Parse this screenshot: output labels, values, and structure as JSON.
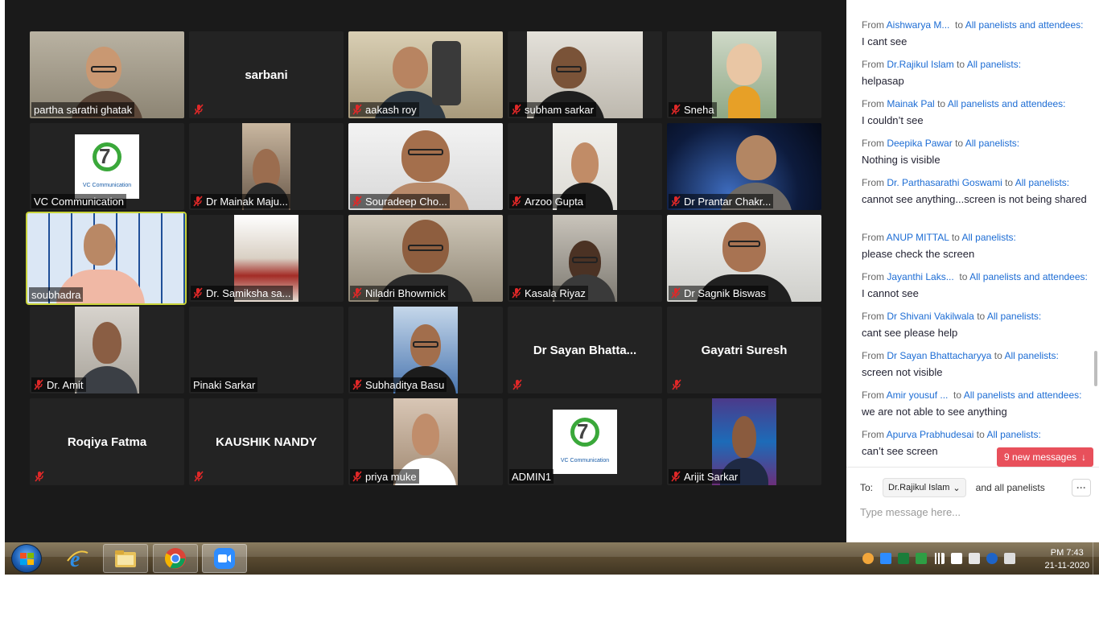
{
  "participants": [
    {
      "name": "partha sarathi ghatak",
      "muted": false
    },
    {
      "name": "sarbani",
      "muted": true
    },
    {
      "name": "aakash roy",
      "muted": true
    },
    {
      "name": "subham sarkar",
      "muted": true
    },
    {
      "name": "Sneha",
      "muted": true
    },
    {
      "name": "VC Communication",
      "muted": false
    },
    {
      "name": "Dr Mainak Maju...",
      "muted": true
    },
    {
      "name": "Souradeep Cho...",
      "muted": true
    },
    {
      "name": "Arzoo Gupta",
      "muted": true
    },
    {
      "name": "Dr Prantar Chakr...",
      "muted": true
    },
    {
      "name": "soubhadra",
      "muted": false
    },
    {
      "name": "Dr.  Samiksha sa...",
      "muted": true
    },
    {
      "name": "Niladri Bhowmick",
      "muted": true
    },
    {
      "name": "Kasala Riyaz",
      "muted": true
    },
    {
      "name": "Dr Sagnik Biswas",
      "muted": true
    },
    {
      "name": "Dr. Amit",
      "muted": true
    },
    {
      "name": "Pinaki Sarkar",
      "muted": false
    },
    {
      "name": "Subhaditya Basu",
      "muted": true
    },
    {
      "name": "Dr Sayan  Bhatta...",
      "muted": true
    },
    {
      "name": "Gayatri Suresh",
      "muted": true
    },
    {
      "name": "Roqiya Fatma",
      "muted": true
    },
    {
      "name": "KAUSHIK NANDY",
      "muted": true
    },
    {
      "name": "priya muke",
      "muted": true
    },
    {
      "name": "ADMIN1",
      "muted": false
    },
    {
      "name": "Arijit Sarkar",
      "muted": true
    }
  ],
  "logo_caption": "VC Communication",
  "chat": {
    "messages": [
      {
        "from": "Aishwarya M...",
        "to": "All panelists and attendees:",
        "text": "I cant see"
      },
      {
        "from": "Dr.Rajikul Islam",
        "to": "All panelists:",
        "text": "helpasap"
      },
      {
        "from": "Mainak Pal",
        "to": "All panelists and attendees:",
        "text": "I couldn’t see"
      },
      {
        "from": "Deepika Pawar",
        "to": "All panelists:",
        "text": "Nothing is visible"
      },
      {
        "from": "Dr. Parthasarathi Goswami",
        "to": "All panelists:",
        "text": "cannot see anything...screen is not being shared"
      },
      {
        "from": "ANUP MITTAL",
        "to": "All panelists:",
        "text": "please check the screen"
      },
      {
        "from": "Jayanthi Laks...",
        "to": "All panelists and attendees:",
        "text": "I cannot see"
      },
      {
        "from": "Dr Shivani Vakilwala",
        "to": "All panelists:",
        "text": "cant see please help"
      },
      {
        "from": "Dr Sayan Bhattacharyya",
        "to": "All panelists:",
        "text": "screen not visible"
      },
      {
        "from": "Amir yousuf ...",
        "to": "All panelists and attendees:",
        "text": "we are not able to see anything"
      },
      {
        "from": "Apurva Prabhudesai",
        "to": "All panelists:",
        "text": "can’t see screen"
      }
    ],
    "from_word": "From",
    "to_word": "to",
    "new_messages": "9 new messages",
    "to_label": "To:",
    "recipient": "Dr.Rajikul Islam",
    "recipient_suffix": "and all panelists",
    "more": "···",
    "placeholder": "Type message here..."
  },
  "taskbar": {
    "time": "PM 7:43",
    "date": "21-11-2020",
    "apps": [
      "internet-explorer",
      "file-explorer",
      "chrome",
      "zoom"
    ]
  },
  "colors": {
    "meeting_bg": "#1a1a1a",
    "tile_bg": "#232323",
    "active_speaker": "#c8d33a",
    "link_blue": "#1c6cd4",
    "new_msg_badge": "#e8505b",
    "mute_red": "#e02828"
  }
}
